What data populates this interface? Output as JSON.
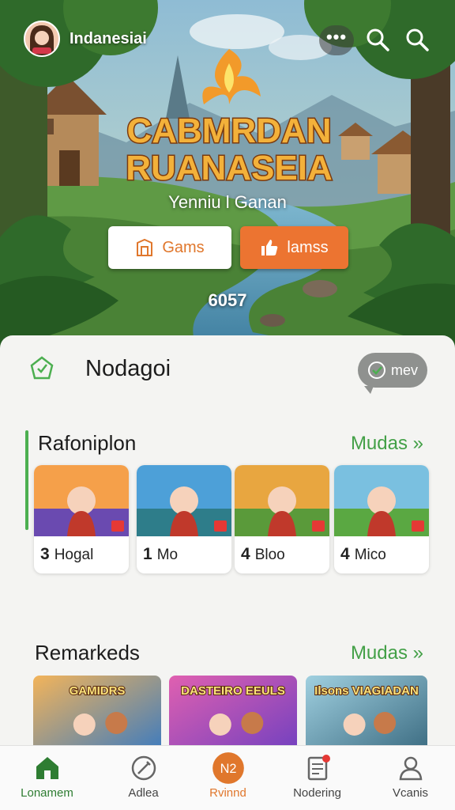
{
  "header": {
    "username": "Indanesiai",
    "more_label": "•••"
  },
  "hero": {
    "logo_line1": "CABMRDAN",
    "logo_line2": "RUANASEIA",
    "subtitle": "Yenniu l Ganan",
    "btn_games": "Gams",
    "btn_items": "lamss",
    "count": "6057"
  },
  "sheet": {
    "title": "Nodagoi",
    "view_label": "mev"
  },
  "section1": {
    "title": "Rafoniplon",
    "more": "Mudas »",
    "cards": [
      {
        "num": "3",
        "name": "Hogal",
        "badge": "3",
        "colors": [
          "#f5a04a",
          "#6a4ab0"
        ]
      },
      {
        "num": "1",
        "name": "Mo",
        "badge": "1",
        "colors": [
          "#4da0d8",
          "#2e7d8a"
        ]
      },
      {
        "num": "4",
        "name": "Bloo",
        "badge": "4",
        "colors": [
          "#e8a640",
          "#5a9a3a"
        ]
      },
      {
        "num": "4",
        "name": "Mico",
        "badge": "4",
        "colors": [
          "#7ac0e0",
          "#5aa842"
        ]
      }
    ]
  },
  "section2": {
    "title": "Remarkeds",
    "more": "Mudas »",
    "banners": [
      {
        "title": "GAMIDRS",
        "colors": [
          "#f3b45a",
          "#3a7ac0"
        ]
      },
      {
        "title": "DASTEIRO EEULS",
        "colors": [
          "#e060b0",
          "#7040c0"
        ]
      },
      {
        "title": "Ilsons VIAGIADAN",
        "colors": [
          "#a0d0e0",
          "#3a6a80"
        ]
      }
    ]
  },
  "nav": [
    {
      "label": "Lonamem",
      "icon": "home-icon"
    },
    {
      "label": "Adlea",
      "icon": "pencil-icon"
    },
    {
      "label": "Rvinnd",
      "icon": "n2-badge-icon",
      "badge": "N2"
    },
    {
      "label": "Nodering",
      "icon": "document-icon"
    },
    {
      "label": "Vcanis",
      "icon": "profile-icon"
    }
  ],
  "colors": {
    "accent_orange": "#ec7431",
    "accent_green": "#43a047"
  }
}
